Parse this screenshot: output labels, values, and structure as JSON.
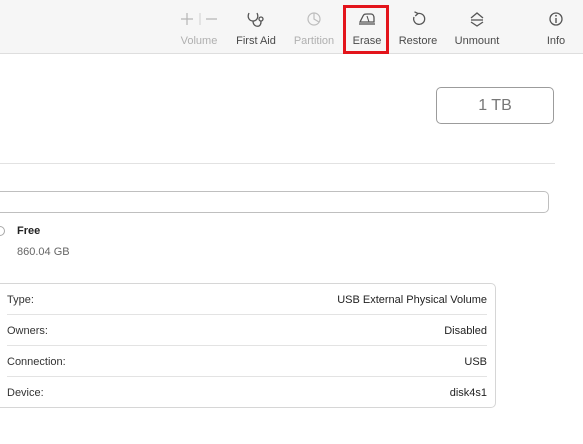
{
  "toolbar": {
    "volume_label": "Volume",
    "first_aid_label": "First Aid",
    "partition_label": "Partition",
    "erase_label": "Erase",
    "restore_label": "Restore",
    "unmount_label": "Unmount",
    "info_label": "Info"
  },
  "disk": {
    "capacity": "1 TB"
  },
  "usage": {
    "free_label": "Free",
    "free_value": "860.04 GB"
  },
  "info_rows": [
    {
      "key": "Type:",
      "value": "USB External Physical Volume"
    },
    {
      "key": "Owners:",
      "value": "Disabled"
    },
    {
      "key": "Connection:",
      "value": "USB"
    },
    {
      "key": "Device:",
      "value": "disk4s1"
    }
  ],
  "colors": {
    "highlight": "#e3141b",
    "toolbar_bg": "#f6f6f6",
    "disabled_text": "#b0b0b0"
  },
  "icons": [
    "plus-icon",
    "minus-icon",
    "stethoscope-icon",
    "pie-chart-icon",
    "eraser-icon",
    "restore-icon",
    "unmount-icon",
    "info-icon"
  ]
}
